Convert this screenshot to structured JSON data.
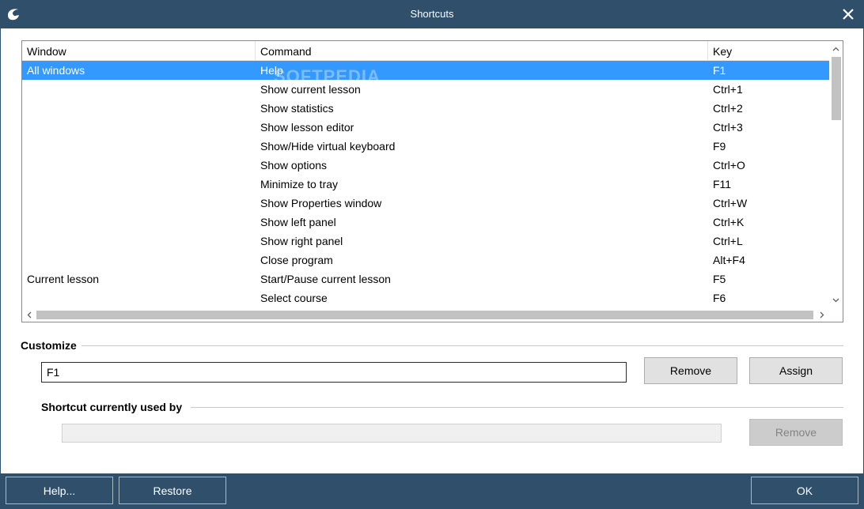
{
  "window": {
    "title": "Shortcuts"
  },
  "list": {
    "columns": [
      "Window",
      "Command",
      "Key"
    ],
    "rows": [
      {
        "window": "All windows",
        "command": "Help",
        "key": "F1",
        "selected": true
      },
      {
        "window": "",
        "command": "Show current lesson",
        "key": "Ctrl+1"
      },
      {
        "window": "",
        "command": "Show statistics",
        "key": "Ctrl+2"
      },
      {
        "window": "",
        "command": "Show lesson editor",
        "key": "Ctrl+3"
      },
      {
        "window": "",
        "command": "Show/Hide virtual keyboard",
        "key": "F9"
      },
      {
        "window": "",
        "command": "Show options",
        "key": "Ctrl+O"
      },
      {
        "window": "",
        "command": "Minimize to tray",
        "key": "F11"
      },
      {
        "window": "",
        "command": "Show Properties window",
        "key": "Ctrl+W"
      },
      {
        "window": "",
        "command": "Show left panel",
        "key": "Ctrl+K"
      },
      {
        "window": "",
        "command": "Show right panel",
        "key": "Ctrl+L"
      },
      {
        "window": "",
        "command": "Close program",
        "key": "Alt+F4"
      },
      {
        "window": "Current lesson",
        "command": "Start/Pause current lesson",
        "key": "F5"
      },
      {
        "window": "",
        "command": "Select course",
        "key": "F6"
      }
    ],
    "watermark": "SOFTPEDIA"
  },
  "customize": {
    "label": "Customize",
    "shortcut_value": "F1",
    "remove_label": "Remove",
    "assign_label": "Assign"
  },
  "used_by": {
    "label": "Shortcut currently used by",
    "value": "",
    "remove_label": "Remove"
  },
  "footer": {
    "help_label": "Help...",
    "restore_label": "Restore",
    "ok_label": "OK"
  },
  "colors": {
    "chrome": "#2f4f6b",
    "selection": "#3399ff"
  }
}
